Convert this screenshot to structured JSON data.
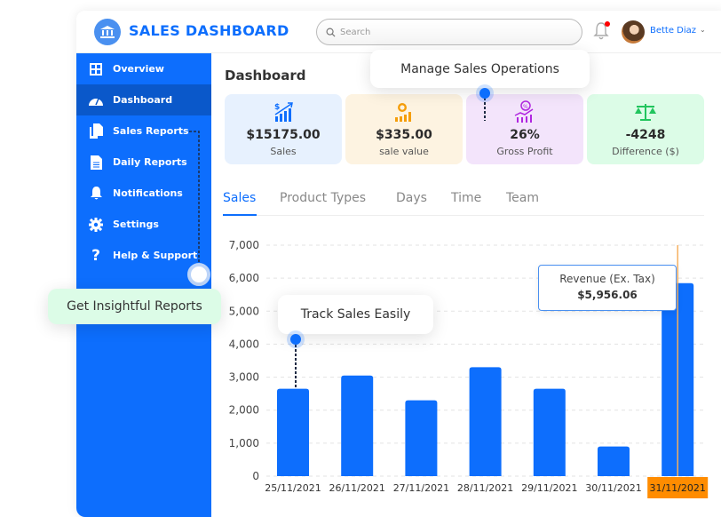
{
  "app": {
    "title": "SALES DASHBOARD",
    "logo_icon": "bank-building-icon"
  },
  "header": {
    "search": {
      "placeholder": "Search",
      "value": ""
    },
    "notification_icon": "bell-icon",
    "notification_badge": true,
    "user": {
      "name": "Bette Diaz",
      "dropdown_icon": "chevron-down-icon"
    }
  },
  "sidebar": {
    "items": [
      {
        "label": "Overview",
        "icon": "grid-icon",
        "active": false
      },
      {
        "label": "Dashboard",
        "icon": "gauge-icon",
        "active": true
      },
      {
        "label": "Sales Reports",
        "icon": "copy-documents-icon",
        "active": false
      },
      {
        "label": "Daily Reports",
        "icon": "document-icon",
        "active": false
      },
      {
        "label": "Notifications",
        "icon": "bell-icon",
        "active": false
      },
      {
        "label": "Settings",
        "icon": "gear-icon",
        "active": false
      },
      {
        "label": "Help & Support",
        "icon": "question-icon",
        "active": false
      }
    ]
  },
  "main": {
    "title": "Dashboard",
    "cards": [
      {
        "value": "$15175.00",
        "label": "Sales",
        "icon": "dollar-chart-up-icon",
        "bg": "#e7f1fe",
        "icon_color": "#0d6efd"
      },
      {
        "value": "$335.00",
        "label": "sale value",
        "icon": "coin-bars-icon",
        "bg": "#fdf3e1",
        "icon_color": "#f59e0b"
      },
      {
        "value": "26%",
        "label": "Gross Profit",
        "icon": "percent-chart-icon",
        "bg": "#f3e4fb",
        "icon_color": "#b026e0"
      },
      {
        "value": "-4248",
        "label": "Difference ($)",
        "icon": "scales-icon",
        "bg": "#dcfce7",
        "icon_color": "#22c55e"
      }
    ],
    "tabs": [
      {
        "label": "Sales",
        "active": true
      },
      {
        "label": "Product Types",
        "active": false
      },
      {
        "label": "Days",
        "active": false
      },
      {
        "label": "Time",
        "active": false
      },
      {
        "label": "Team",
        "active": false
      }
    ],
    "tooltip": {
      "title": "Revenue (Ex. Tax)",
      "value": "$5,956.06"
    }
  },
  "callouts": {
    "manage": "Manage Sales Operations",
    "insights": "Get Insightful Reports",
    "track": "Track Sales Easily"
  },
  "colors": {
    "primary": "#0d6efd",
    "sidebar_active": "#0a58ca",
    "highlight": "#ff8c00"
  },
  "chart_data": {
    "type": "bar",
    "title": "",
    "xlabel": "",
    "ylabel": "",
    "categories": [
      "25/11/2021",
      "26/11/2021",
      "27/11/2021",
      "28/11/2021",
      "29/11/2021",
      "30/11/2021",
      "31/11/2021"
    ],
    "values": [
      2650,
      3050,
      2300,
      3300,
      2650,
      900,
      5850
    ],
    "ylim": [
      0,
      7000
    ],
    "yticks": [
      0,
      1000,
      2000,
      3000,
      4000,
      5000,
      6000,
      7000
    ],
    "ytick_labels": [
      "0",
      "1,000",
      "2,000",
      "3,000",
      "4,000",
      "5,000",
      "6,000",
      "7,000"
    ],
    "grid": true,
    "highlighted_category": "31/11/2021",
    "bar_color": "#0d6efd"
  }
}
